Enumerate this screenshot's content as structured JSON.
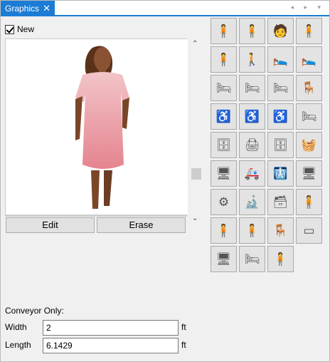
{
  "tab": {
    "title": "Graphics",
    "close_glyph": "✕",
    "nav": "◂ ▸ ▾"
  },
  "new_checkbox": {
    "label": "New",
    "checked": true
  },
  "preview": {
    "subject": "Patient in pink gown"
  },
  "buttons": {
    "edit": "Edit",
    "erase": "Erase"
  },
  "scrollbar": {
    "up": "⌃",
    "down": "⌄"
  },
  "gallery": [
    {
      "icon": "seated-patient-icon",
      "glyph": "🧍"
    },
    {
      "icon": "standing-man-icon",
      "glyph": "🧍"
    },
    {
      "icon": "doctor-icon",
      "glyph": "🧑"
    },
    {
      "icon": "surgeon-icon",
      "glyph": "🧍"
    },
    {
      "icon": "person-with-iv-icon",
      "glyph": "🧍"
    },
    {
      "icon": "walking-patient-icon",
      "glyph": "🚶"
    },
    {
      "icon": "lying-patient-icon",
      "glyph": "🛌"
    },
    {
      "icon": "lying-patient-blue-icon",
      "glyph": "🛌"
    },
    {
      "icon": "gurney-icon",
      "glyph": "🛏"
    },
    {
      "icon": "exam-table-icon",
      "glyph": "🛏"
    },
    {
      "icon": "stretcher-icon",
      "glyph": "🛏"
    },
    {
      "icon": "chair-icon",
      "glyph": "🪑"
    },
    {
      "icon": "wheelchair-icon",
      "glyph": "♿"
    },
    {
      "icon": "wheelchair-patient-icon",
      "glyph": "♿"
    },
    {
      "icon": "wheelchair-seated-icon",
      "glyph": "♿"
    },
    {
      "icon": "bed-outline-icon",
      "glyph": "🛏"
    },
    {
      "icon": "cart-icon",
      "glyph": "🗄"
    },
    {
      "icon": "equipment-stand-icon",
      "glyph": "🖨"
    },
    {
      "icon": "trolley-icon",
      "glyph": "🗄"
    },
    {
      "icon": "blanket-icon",
      "glyph": "🧺"
    },
    {
      "icon": "xray-machine-icon",
      "glyph": "🖥"
    },
    {
      "icon": "ambulance-icon",
      "glyph": "🚑"
    },
    {
      "icon": "scanner-icon",
      "glyph": "🩻"
    },
    {
      "icon": "monitor-device-icon",
      "glyph": "🖥"
    },
    {
      "icon": "mri-icon",
      "glyph": "⚙"
    },
    {
      "icon": "microscope-icon",
      "glyph": "🔬"
    },
    {
      "icon": "desk-icon",
      "glyph": "🗃"
    },
    {
      "icon": "nurse-icon",
      "glyph": "🧍"
    },
    {
      "icon": "standing-patient-icon",
      "glyph": "🧍"
    },
    {
      "icon": "patient-gown-icon",
      "glyph": "🧍"
    },
    {
      "icon": "seated-person-icon",
      "glyph": "🪑"
    },
    {
      "icon": "blank-bar-icon",
      "glyph": "▭"
    },
    {
      "icon": "dialysis-machine-icon",
      "glyph": "🖥"
    },
    {
      "icon": "conveyor-bed-icon",
      "glyph": "🛏"
    },
    {
      "icon": "standing-dark-figure-icon",
      "glyph": "🧍"
    }
  ],
  "conveyor": {
    "section_label": "Conveyor Only:",
    "width_label": "Width",
    "width_value": "2",
    "width_unit": "ft",
    "length_label": "Length",
    "length_value": "6.1429",
    "length_unit": "ft"
  }
}
